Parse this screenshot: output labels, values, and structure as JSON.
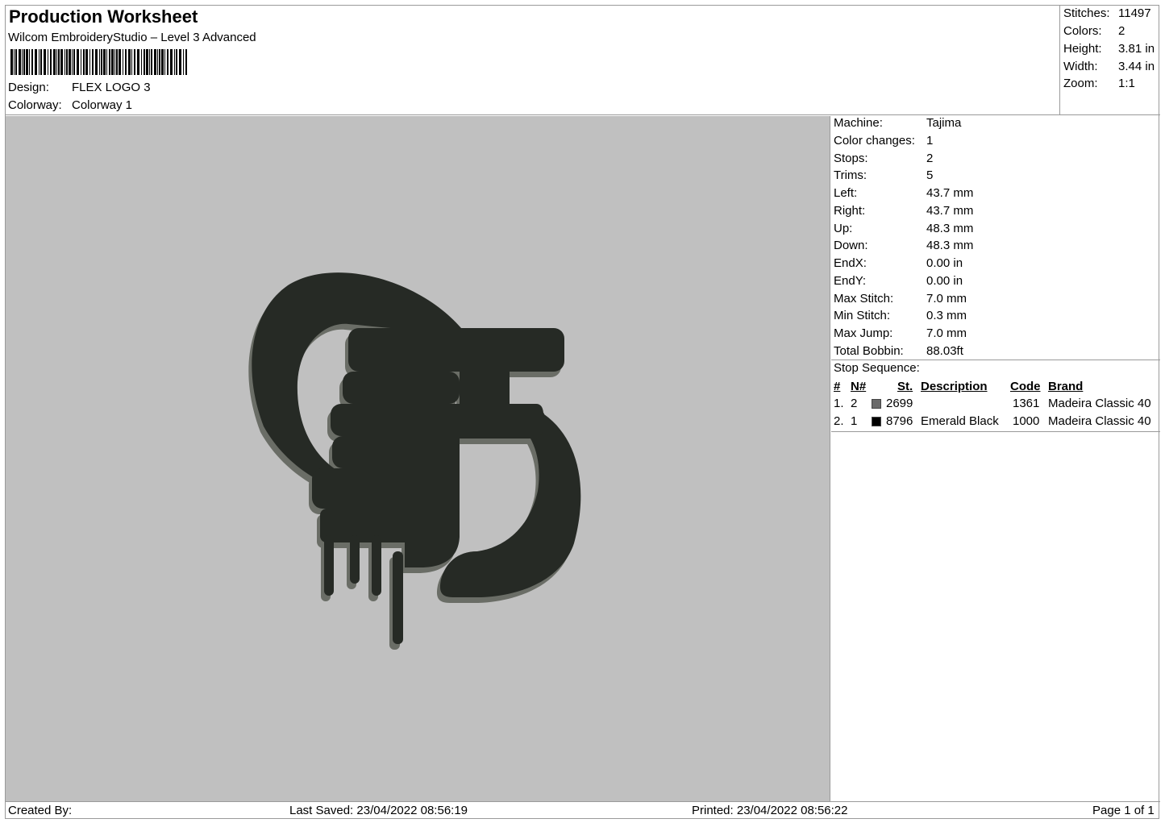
{
  "header": {
    "title": "Production Worksheet",
    "subtitle": "Wilcom EmbroideryStudio – Level 3 Advanced",
    "design_label": "Design:",
    "design_value": "FLEX LOGO 3",
    "colorway_label": "Colorway:",
    "colorway_value": "Colorway 1"
  },
  "summary": [
    {
      "label": "Stitches:",
      "value": "11497"
    },
    {
      "label": "Colors:",
      "value": "2"
    },
    {
      "label": "Height:",
      "value": "3.81 in"
    },
    {
      "label": "Width:",
      "value": "3.44 in"
    },
    {
      "label": "Zoom:",
      "value": "1:1"
    }
  ],
  "details": [
    {
      "label": "Machine:",
      "value": "Tajima"
    },
    {
      "label": "Color changes:",
      "value": "1"
    },
    {
      "label": "Stops:",
      "value": "2"
    },
    {
      "label": "Trims:",
      "value": "5"
    },
    {
      "label": "Left:",
      "value": "43.7 mm"
    },
    {
      "label": "Right:",
      "value": "43.7 mm"
    },
    {
      "label": "Up:",
      "value": "48.3 mm"
    },
    {
      "label": "Down:",
      "value": "48.3 mm"
    },
    {
      "label": "EndX:",
      "value": "0.00 in"
    },
    {
      "label": "EndY:",
      "value": "0.00 in"
    },
    {
      "label": "Max Stitch:",
      "value": "7.0 mm"
    },
    {
      "label": "Min Stitch:",
      "value": "0.3 mm"
    },
    {
      "label": "Max Jump:",
      "value": "7.0 mm"
    },
    {
      "label": "Total Bobbin:",
      "value": "88.03ft"
    }
  ],
  "stop_sequence": {
    "title": "Stop Sequence:",
    "columns": [
      "#",
      "N#",
      "St.",
      "Description",
      "Code",
      "Brand"
    ],
    "rows": [
      {
        "num": "1.",
        "n": "2",
        "color": "#6b6b6b",
        "st": "2699",
        "description": "",
        "code": "1361",
        "brand": "Madeira Classic 40"
      },
      {
        "num": "2.",
        "n": "1",
        "color": "#000000",
        "st": "8796",
        "description": "Emerald Black",
        "code": "1000",
        "brand": "Madeira Classic 40"
      }
    ]
  },
  "colors": {
    "preview_bg": "#c0c0c0",
    "thread_dark": "#262a25",
    "thread_shadow": "#6a6d66"
  },
  "footer": {
    "created_by": "Created By:",
    "last_saved": "Last Saved: 23/04/2022 08:56:19",
    "printed": "Printed: 23/04/2022 08:56:22",
    "page": "Page 1 of 1"
  }
}
